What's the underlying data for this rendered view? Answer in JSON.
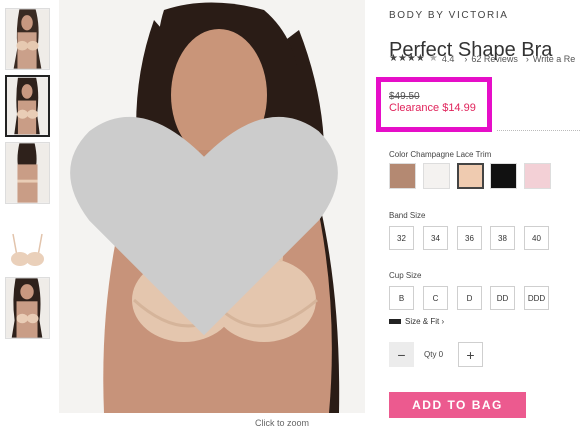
{
  "brand": "BODY BY VICTORIA",
  "product_title": "Perfect Shape Bra",
  "rating": {
    "stars_filled": 4.4,
    "stars_max": 5,
    "score": "4.4",
    "reviews": "62 Reviews",
    "write_review": "Write a Re"
  },
  "price": {
    "original": "$49.50",
    "sale": "Clearance $14.99",
    "sale_color": "#e0235b",
    "highlight_color": "#e60ec8"
  },
  "color": {
    "label": "Color Champagne Lace Trim",
    "swatches": [
      {
        "name": "mocha-swatch",
        "fill": "#b48972"
      },
      {
        "name": "white-swatch",
        "fill": "#f4f2f0"
      },
      {
        "name": "champagne-swatch",
        "fill": "#efcbb0"
      },
      {
        "name": "black-swatch",
        "fill": "#111111"
      },
      {
        "name": "pink-dot-swatch",
        "fill": "#f3d0d6"
      }
    ],
    "selected": "champagne-swatch"
  },
  "band_size": {
    "label": "Band Size",
    "options": [
      "32",
      "34",
      "36",
      "38",
      "40"
    ]
  },
  "cup_size": {
    "label": "Cup Size",
    "options": [
      "B",
      "C",
      "D",
      "DD",
      "DDD"
    ]
  },
  "size_fit": "Size & Fit ›",
  "quantity": {
    "minus": "−",
    "label": "Qty 0",
    "plus": "+"
  },
  "add_to_bag": "ADD TO BAG",
  "image_caption": "Click to zoom",
  "accent_color": "#ec5a8f"
}
